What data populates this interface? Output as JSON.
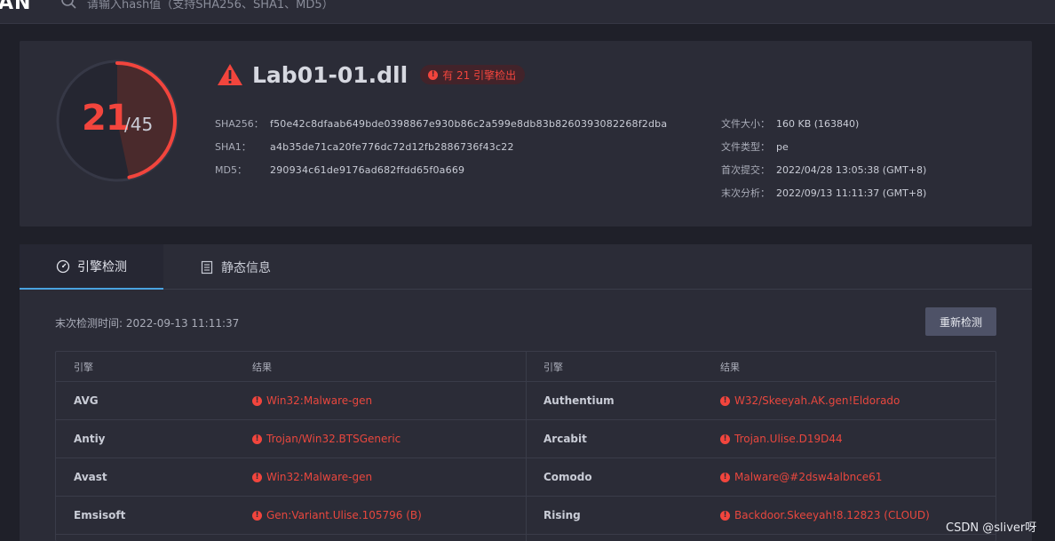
{
  "topbar": {
    "brand": "AN",
    "search_placeholder": "请输入hash值（支持SHA256、SHA1、MD5）"
  },
  "summary": {
    "detected_count": "21",
    "engine_total": "/45",
    "detection_ratio": 0.4667,
    "file_name": "Lab01-01.dll",
    "detect_badge_icon": "!",
    "detect_badge": "有 21 引擎检出",
    "hashes": [
      {
        "label": "SHA256：",
        "value": "f50e42c8dfaab649bde0398867e930b86c2a599e8db83b8260393082268f2dba"
      },
      {
        "label": "SHA1：",
        "value": "a4b35de71ca20fe776dc72d12fb2886736f43c22"
      },
      {
        "label": "MD5：",
        "value": "290934c61de9176ad682ffdd65f0a669"
      }
    ],
    "meta": [
      {
        "label": "文件大小：",
        "value": "160 KB (163840)"
      },
      {
        "label": "文件类型：",
        "value": "pe"
      },
      {
        "label": "首次提交：",
        "value": "2022/04/28 13:05:38 (GMT+8)"
      },
      {
        "label": "末次分析：",
        "value": "2022/09/13 11:11:37 (GMT+8)"
      }
    ]
  },
  "tabs": [
    {
      "label": "引擎检测",
      "icon": "gauge-icon",
      "active": true
    },
    {
      "label": "静态信息",
      "icon": "document-icon",
      "active": false
    }
  ],
  "detection": {
    "last_detect": "末次检测时间: 2022-09-13 11:11:37",
    "rescan_label": "重新检测",
    "result_icon": "!",
    "headers": {
      "engine": "引擎",
      "result": "结果"
    },
    "rows": [
      {
        "left_engine": "AVG",
        "left_result": "Win32:Malware-gen",
        "right_engine": "Authentium",
        "right_result": "W32/Skeeyah.AK.gen!Eldorado"
      },
      {
        "left_engine": "Antiy",
        "left_result": "Trojan/Win32.BTSGeneric",
        "right_engine": "Arcabit",
        "right_result": "Trojan.Ulise.D19D44"
      },
      {
        "left_engine": "Avast",
        "left_result": "Win32:Malware-gen",
        "right_engine": "Comodo",
        "right_result": "Malware@#2dsw4albnce61"
      },
      {
        "left_engine": "Emsisoft",
        "left_result": "Gen:Variant.Ulise.105796 (B)",
        "right_engine": "Rising",
        "right_result": "Backdoor.Skeeyah!8.12823 (CLOUD)"
      }
    ]
  },
  "watermark": "CSDN @sliver呀",
  "colors": {
    "background": "#1f2029",
    "card": "#2b2c37",
    "danger": "#f2453d",
    "tab_accent": "#4aa3e0",
    "button": "#4e5267"
  }
}
